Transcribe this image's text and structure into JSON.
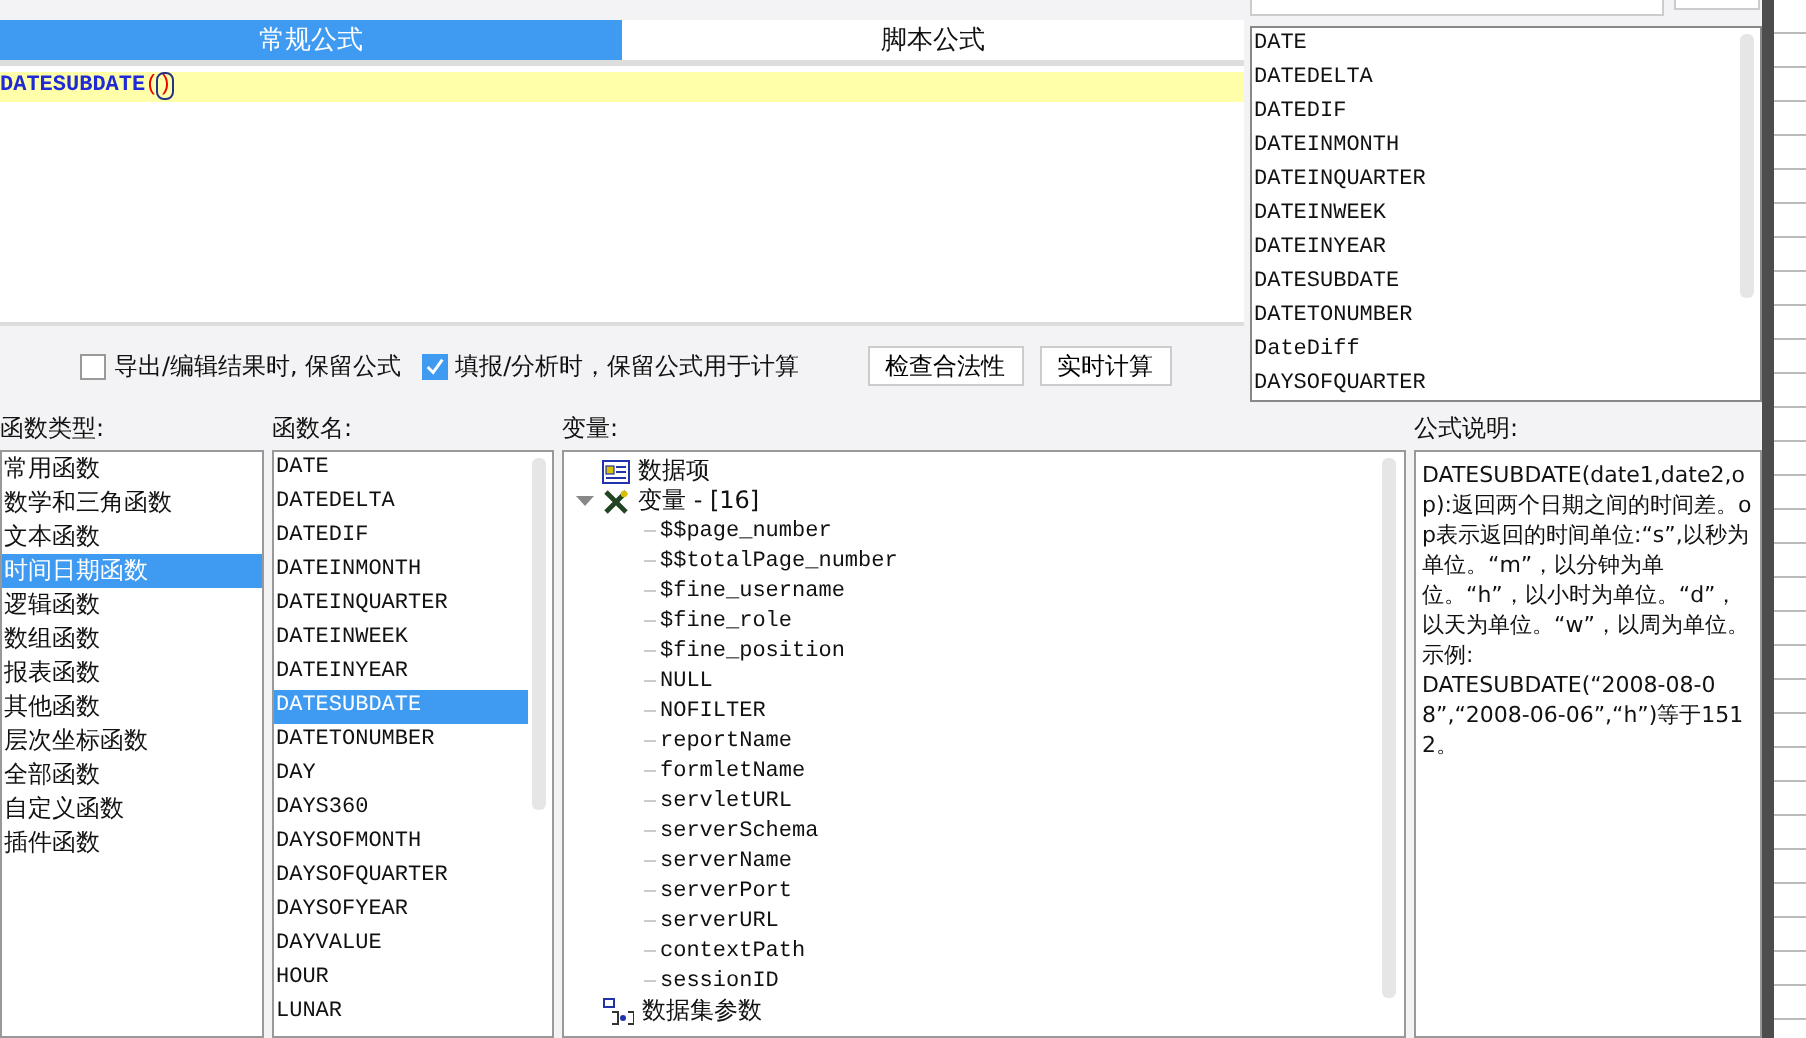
{
  "tabs": [
    {
      "label": "常规公式",
      "selected": true
    },
    {
      "label": "脚本公式",
      "selected": false
    }
  ],
  "editor": {
    "function_name": "DATESUBDATE",
    "open_paren": "(",
    "close_paren": ")"
  },
  "function_list": [
    "DATE",
    "DATEDELTA",
    "DATEDIF",
    "DATEINMONTH",
    "DATEINQUARTER",
    "DATEINWEEK",
    "DATEINYEAR",
    "DATESUBDATE",
    "DATETONUMBER",
    "DateDiff",
    "DAYSOFQUARTER"
  ],
  "options": [
    {
      "label": "导出/编辑结果时, 保留公式",
      "checked": false
    },
    {
      "label": "填报/分析时，保留公式用于计算",
      "checked": true
    }
  ],
  "buttons": [
    "检查合法性",
    "实时计算"
  ],
  "categories": {
    "label": "函数类型:",
    "items": [
      {
        "label": "常用函数",
        "selected": false
      },
      {
        "label": "数学和三角函数",
        "selected": false
      },
      {
        "label": "文本函数",
        "selected": false
      },
      {
        "label": "时间日期函数",
        "selected": true
      },
      {
        "label": "逻辑函数",
        "selected": false
      },
      {
        "label": "数组函数",
        "selected": false
      },
      {
        "label": "报表函数",
        "selected": false
      },
      {
        "label": "其他函数",
        "selected": false
      },
      {
        "label": "层次坐标函数",
        "selected": false
      },
      {
        "label": "全部函数",
        "selected": false
      },
      {
        "label": "自定义函数",
        "selected": false
      },
      {
        "label": "插件函数",
        "selected": false
      }
    ]
  },
  "functions": {
    "label": "函数名:",
    "items": [
      {
        "label": "DATE",
        "selected": false
      },
      {
        "label": "DATEDELTA",
        "selected": false
      },
      {
        "label": "DATEDIF",
        "selected": false
      },
      {
        "label": "DATEINMONTH",
        "selected": false
      },
      {
        "label": "DATEINQUARTER",
        "selected": false
      },
      {
        "label": "DATEINWEEK",
        "selected": false
      },
      {
        "label": "DATEINYEAR",
        "selected": false
      },
      {
        "label": "DATESUBDATE",
        "selected": true
      },
      {
        "label": "DATETONUMBER",
        "selected": false
      },
      {
        "label": "DAY",
        "selected": false
      },
      {
        "label": "DAYS360",
        "selected": false
      },
      {
        "label": "DAYSOFMONTH",
        "selected": false
      },
      {
        "label": "DAYSOFQUARTER",
        "selected": false
      },
      {
        "label": "DAYSOFYEAR",
        "selected": false
      },
      {
        "label": "DAYVALUE",
        "selected": false
      },
      {
        "label": "HOUR",
        "selected": false
      },
      {
        "label": "LUNAR",
        "selected": false
      }
    ]
  },
  "variables": {
    "label": "变量:",
    "tree": [
      {
        "kind": "data",
        "label": "数据项"
      },
      {
        "kind": "variables",
        "label": "变量 - [16]",
        "expanded": true,
        "children": [
          "$$page_number",
          "$$totalPage_number",
          "$fine_username",
          "$fine_role",
          "$fine_position",
          "NULL",
          "NOFILTER",
          "reportName",
          "formletName",
          "servletURL",
          "serverSchema",
          "serverName",
          "serverPort",
          "serverURL",
          "contextPath",
          "sessionID"
        ]
      },
      {
        "kind": "dataset",
        "label": "数据集参数"
      }
    ]
  },
  "description": {
    "label": "公式说明:",
    "paragraphs": [
      "DATESUBDATE(date1,date2,op):返回两个日期之间的时间差。op表示返回的时间单位:“s”,以秒为单位。“m”，以分钟为单位。“h”，以小时为单位。“d”，以天为单位。“w”，以周为单位。",
      "示例:",
      "DATESUBDATE(“2008-08-08”,“2008-06-06”,“h”)等于1512。"
    ]
  }
}
